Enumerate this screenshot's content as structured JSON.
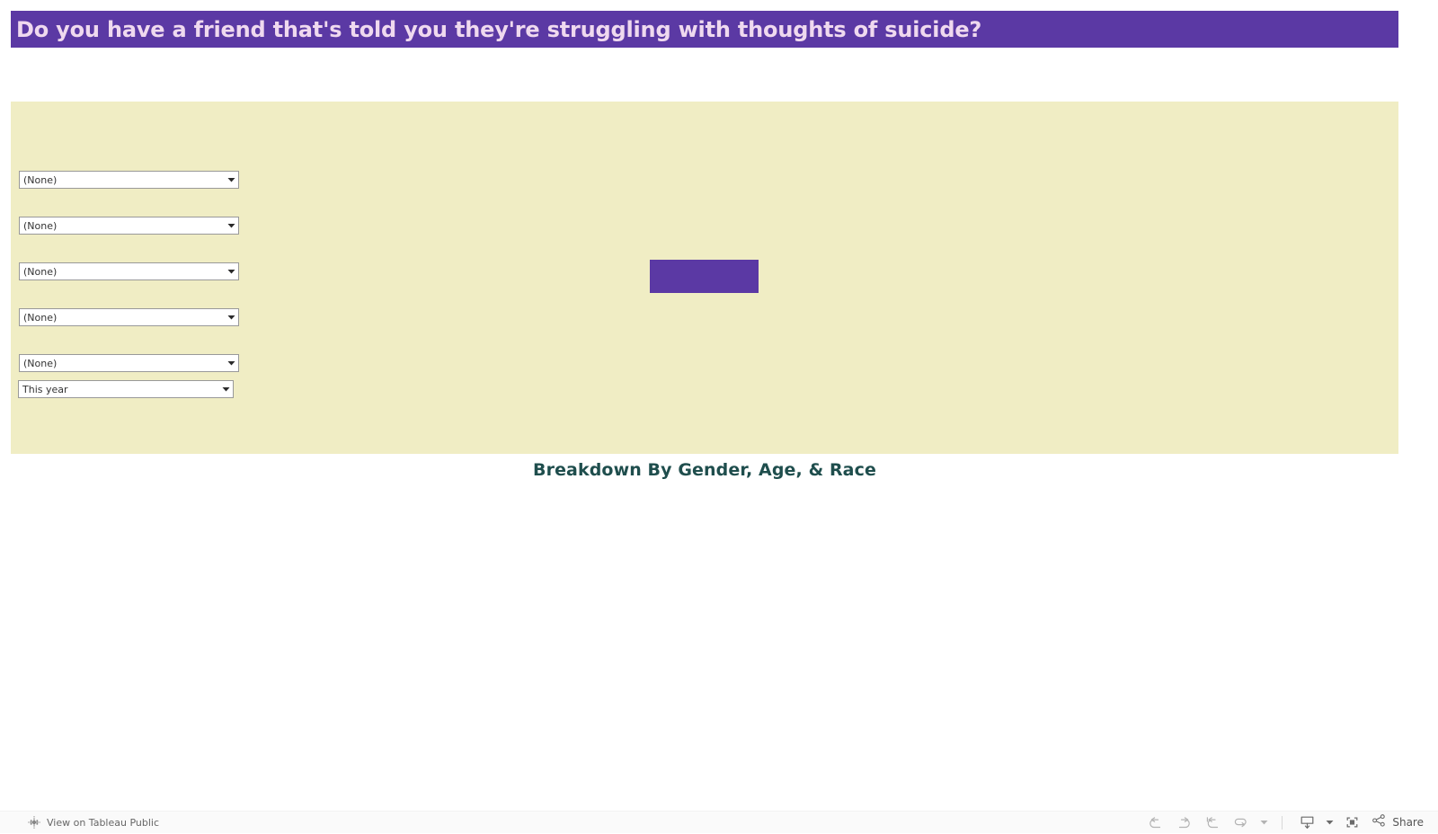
{
  "colors": {
    "accent_purple": "#5b39a4",
    "panel_cream": "#f0edc4",
    "title_text": "#efd9ef",
    "worksheet_title": "#1f4e4d",
    "toolbar_bg": "#fafafa"
  },
  "header": {
    "title": "Do you have a friend that's told you they're struggling with thoughts of suicide?"
  },
  "filters": {
    "dropdowns": [
      {
        "value": "(None)",
        "caret_icon": "chevron-down-icon"
      },
      {
        "value": "(None)",
        "caret_icon": "chevron-down-icon"
      },
      {
        "value": "(None)",
        "caret_icon": "chevron-down-icon"
      },
      {
        "value": "(None)",
        "caret_icon": "chevron-down-icon"
      },
      {
        "value": "(None)",
        "caret_icon": "chevron-down-icon"
      },
      {
        "value": "This year",
        "caret_icon": "chevron-down-icon"
      }
    ]
  },
  "worksheet": {
    "title": "Breakdown By Gender, Age, & Race"
  },
  "toolbar": {
    "tableau_link": "View on Tableau Public",
    "tableau_icon": "tableau-logo-icon",
    "buttons": [
      {
        "name": "undo-button",
        "icon": "undo-icon"
      },
      {
        "name": "redo-button",
        "icon": "redo-icon"
      },
      {
        "name": "revert-button",
        "icon": "revert-all-icon"
      },
      {
        "name": "refresh-button",
        "icon": "refresh-icon"
      },
      {
        "name": "pause-menu-button",
        "icon": "chevron-down-icon"
      }
    ],
    "download": {
      "name": "download-button",
      "icon": "download-icon",
      "caret_icon": "chevron-down-icon"
    },
    "fullscreen": {
      "name": "fullscreen-button",
      "icon": "fullscreen-icon"
    },
    "share": {
      "label": "Share",
      "icon": "share-icon"
    }
  }
}
